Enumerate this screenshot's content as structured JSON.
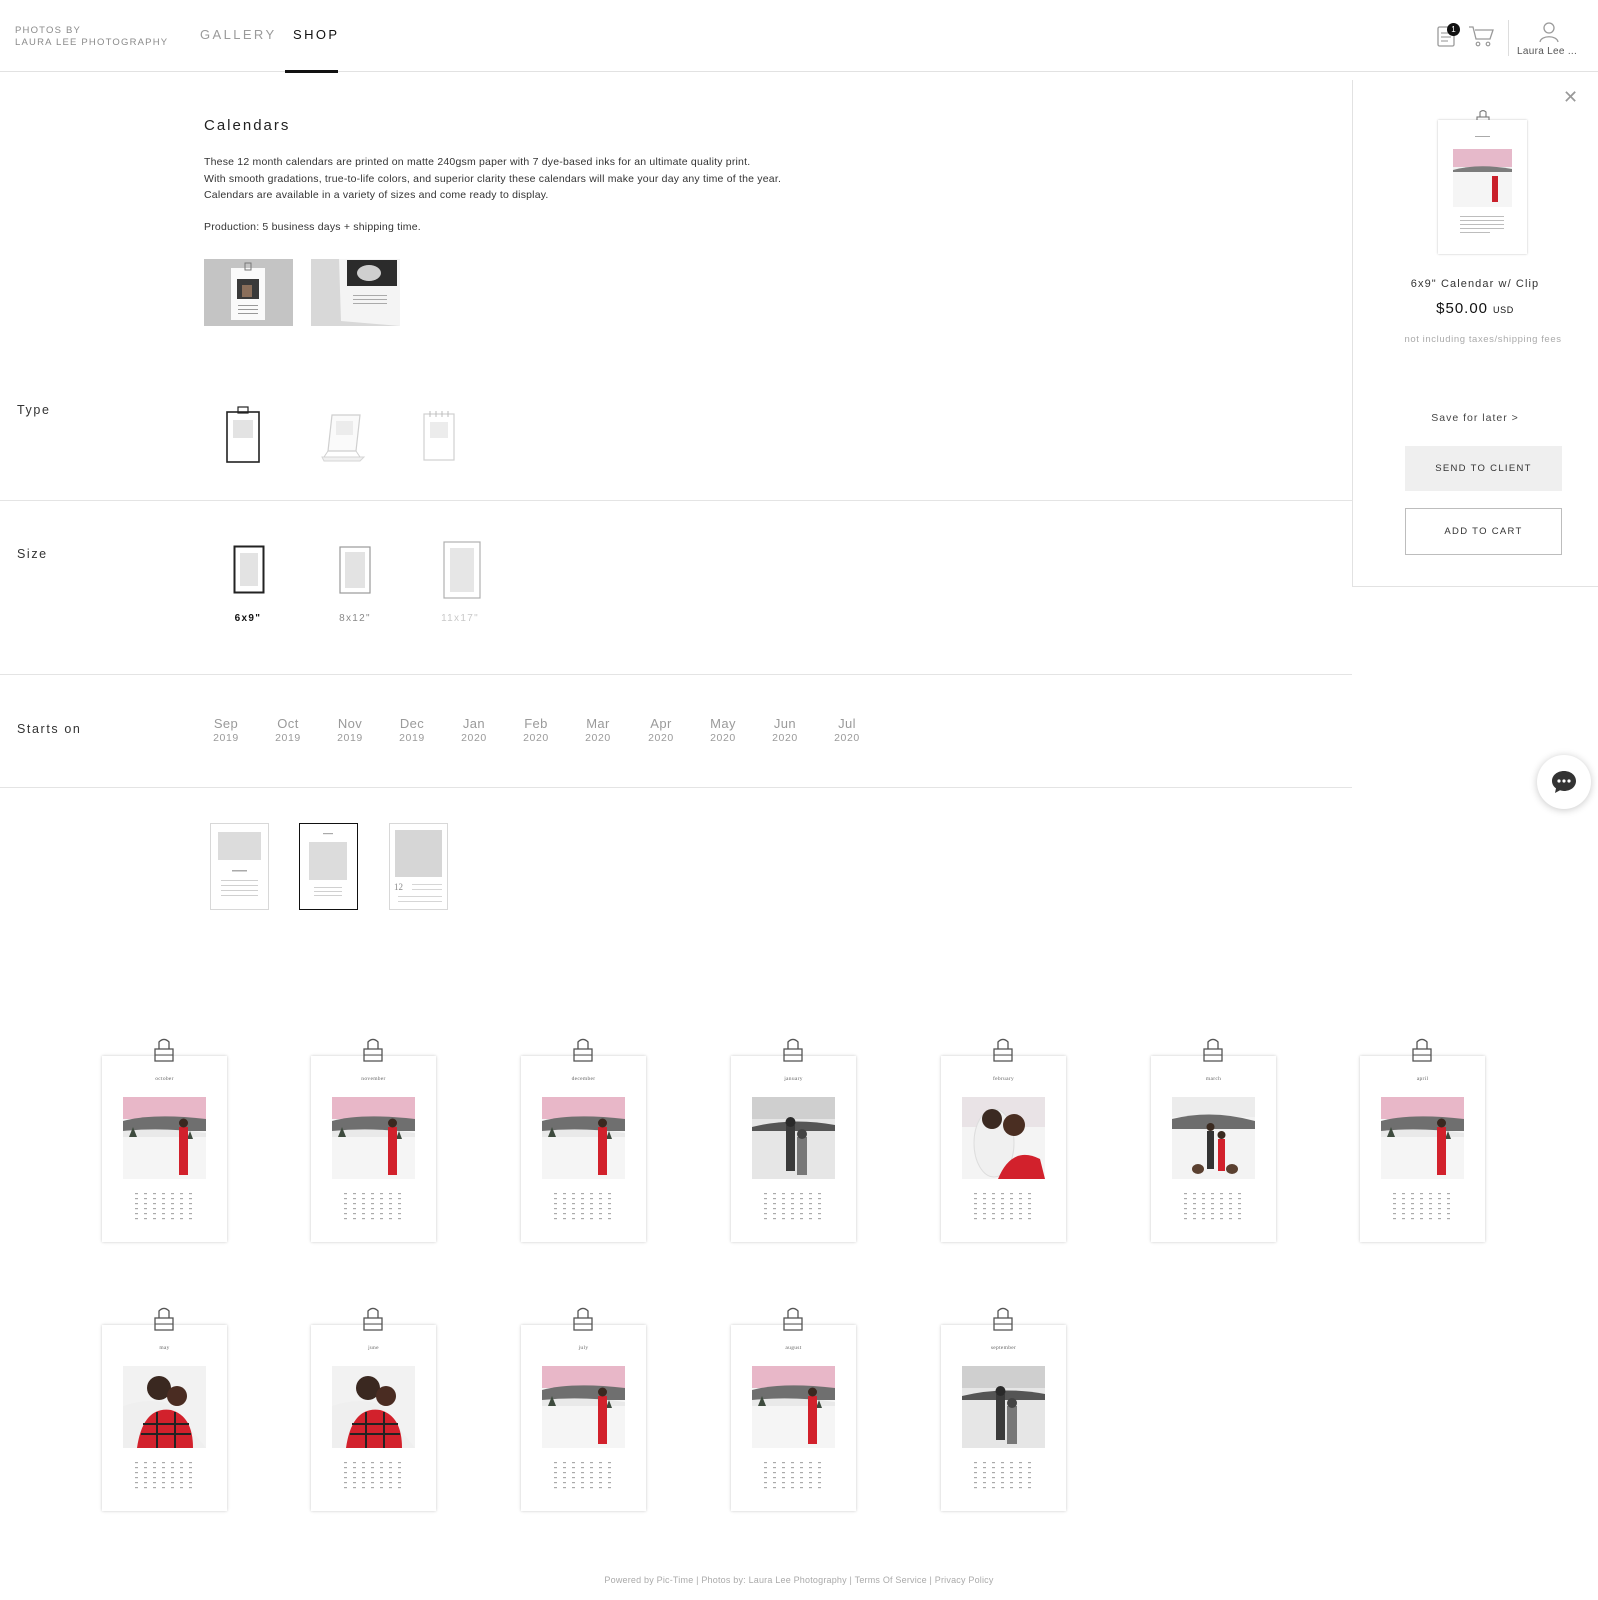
{
  "header": {
    "brand_line1": "PHOTOS BY",
    "brand_line2": "LAURA LEE PHOTOGRAPHY",
    "tabs": [
      {
        "label": "GALLERY"
      },
      {
        "label": "SHOP"
      }
    ],
    "notification_count": "1",
    "user_name": "Laura Lee ..."
  },
  "product": {
    "title": "Calendars",
    "description_lines": [
      "These 12 month calendars are printed on matte 240gsm paper with 7 dye-based inks for an ultimate quality print.",
      "With smooth gradations, true-to-life colors, and superior clarity these calendars will make your day any time of the year.",
      "Calendars are available in a variety of sizes and come ready to display."
    ],
    "production": "Production: 5 business days + shipping time."
  },
  "options": {
    "type_label": "Type",
    "size_label": "Size",
    "sizes": [
      {
        "label": "6x9\""
      },
      {
        "label": "8x12\""
      },
      {
        "label": "11x17\""
      }
    ],
    "starts_label": "Starts on",
    "months": [
      {
        "m": "Sep",
        "y": "2019"
      },
      {
        "m": "Oct",
        "y": "2019"
      },
      {
        "m": "Nov",
        "y": "2019"
      },
      {
        "m": "Dec",
        "y": "2019"
      },
      {
        "m": "Jan",
        "y": "2020"
      },
      {
        "m": "Feb",
        "y": "2020"
      },
      {
        "m": "Mar",
        "y": "2020"
      },
      {
        "m": "Apr",
        "y": "2020"
      },
      {
        "m": "May",
        "y": "2020"
      },
      {
        "m": "Jun",
        "y": "2020"
      },
      {
        "m": "Jul",
        "y": "2020"
      }
    ],
    "style_third_number": "12"
  },
  "panel": {
    "product_name": "6x9\" Calendar w/ Clip",
    "price": "$50.00",
    "currency": "USD",
    "note": "not including taxes/shipping fees",
    "save_later": "Save for later  >",
    "send_button": "SEND TO CLIENT",
    "add_button": "ADD TO CART"
  },
  "calendar_pages": [
    {
      "month": "october",
      "photo": "red"
    },
    {
      "month": "november",
      "photo": "red"
    },
    {
      "month": "december",
      "photo": "red"
    },
    {
      "month": "january",
      "photo": "bw"
    },
    {
      "month": "february",
      "photo": "couple"
    },
    {
      "month": "march",
      "photo": "family"
    },
    {
      "month": "april",
      "photo": "red"
    },
    {
      "month": "may",
      "photo": "plaid"
    },
    {
      "month": "june",
      "photo": "plaid"
    },
    {
      "month": "july",
      "photo": "red"
    },
    {
      "month": "august",
      "photo": "red"
    },
    {
      "month": "september",
      "photo": "bw"
    }
  ],
  "footer": {
    "text": "Powered by Pic-Time  |  Photos by: Laura Lee Photography | Terms Of Service | Privacy Policy"
  },
  "colors": {
    "accent": "#111111",
    "muted": "#9a9a9a",
    "dress_red": "#d2212c",
    "sky_pink": "#e8b7c8"
  }
}
